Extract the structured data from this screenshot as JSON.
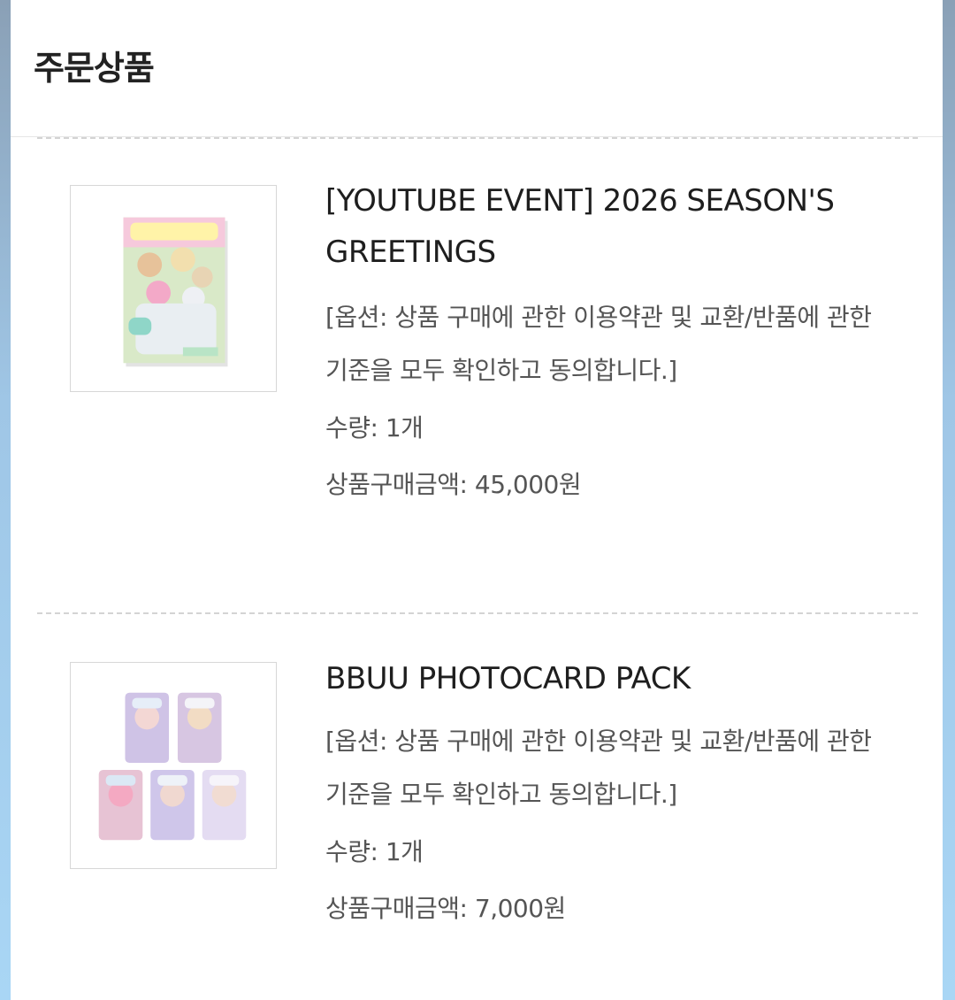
{
  "header": {
    "title": "주문상품"
  },
  "items": [
    {
      "name": "[YOUTUBE EVENT] 2026 SEASON'S GREETINGS",
      "option": "[옵션: 상품 구매에 관한 이용약관 및 교환/반품에 관한 기준을 모두 확인하고 동의합니다.]",
      "quantity": "수량: 1개",
      "price": "상품구매금액: 45,000원"
    },
    {
      "name": "BBUU PHOTOCARD PACK",
      "option": "[옵션: 상품 구매에 관한 이용약관 및 교환/반품에 관한 기준을 모두 확인하고 동의합니다.]",
      "quantity": "수량: 1개",
      "price": "상품구매금액: 7,000원"
    }
  ]
}
